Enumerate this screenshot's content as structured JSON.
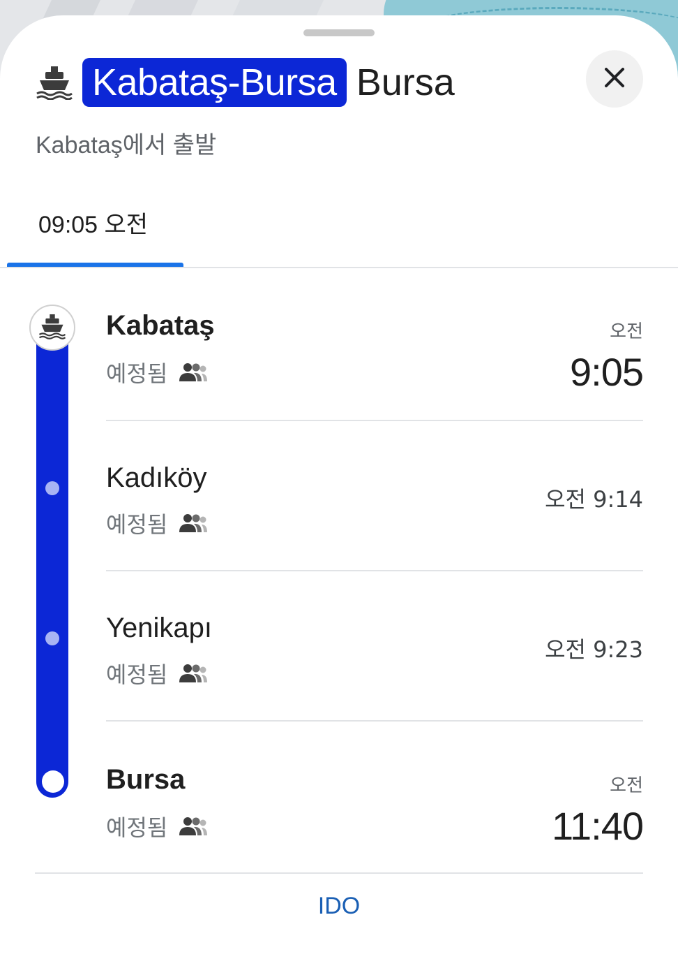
{
  "header": {
    "route_label": "Kabataş-Bursa",
    "destination": "Bursa",
    "subtitle": "Kabataş에서 출발",
    "ferry_icon": "ferry-icon",
    "close_icon": "close-icon"
  },
  "tabs": [
    {
      "label": "09:05 오전",
      "selected": true
    }
  ],
  "stops": [
    {
      "name": "Kabataş",
      "status": "예정됨",
      "time_period": "오전",
      "time": "9:05",
      "bold": true
    },
    {
      "name": "Kadıköy",
      "status": "예정됨",
      "time_inline": "오전 9:14",
      "bold": false
    },
    {
      "name": "Yenikapı",
      "status": "예정됨",
      "time_inline": "오전 9:23",
      "bold": false
    },
    {
      "name": "Bursa",
      "status": "예정됨",
      "time_period": "오전",
      "time": "11:40",
      "bold": true
    }
  ],
  "operator": "IDO",
  "colors": {
    "route_blue": "#0c27d6",
    "accent": "#1a73e8",
    "link": "#1a5fb4"
  }
}
